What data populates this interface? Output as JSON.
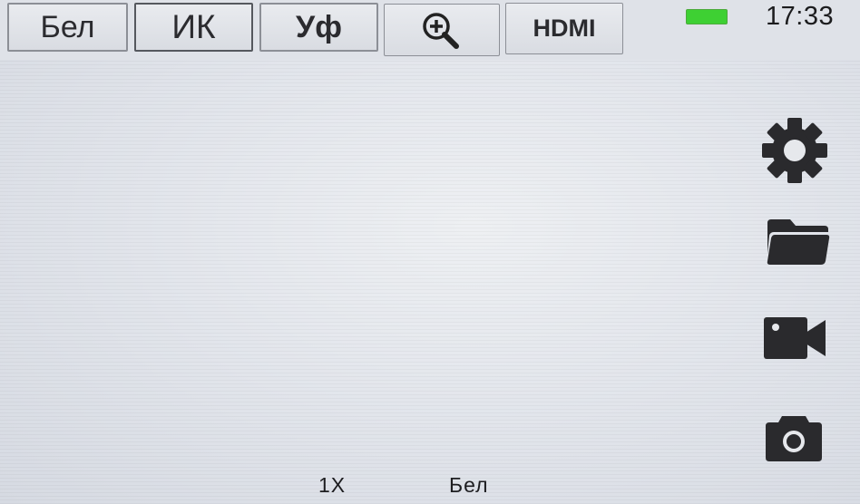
{
  "status_bar": {
    "battery_level": 1.0,
    "battery_color": "#3ed033",
    "time": "17:33"
  },
  "mode_buttons": [
    {
      "label": "Бел"
    },
    {
      "label": "ИК"
    },
    {
      "label": "Уф"
    },
    {
      "icon": "zoom-in-icon"
    },
    {
      "label": "HDMI"
    }
  ],
  "side_controls": [
    {
      "icon": "gear-icon"
    },
    {
      "icon": "folder-icon"
    },
    {
      "icon": "video-camera-icon"
    },
    {
      "icon": "camera-icon"
    }
  ],
  "status_overlay": {
    "zoom": "1X",
    "mode": "Бел"
  }
}
